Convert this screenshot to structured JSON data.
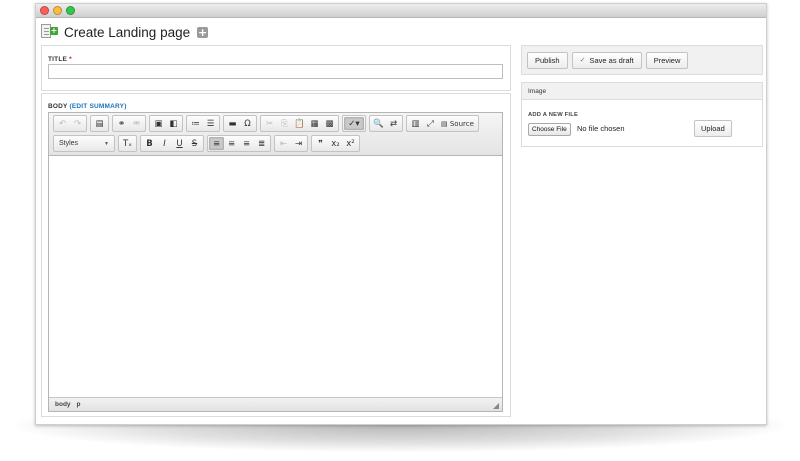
{
  "header": {
    "title": "Create Landing page",
    "add_label": "+"
  },
  "title_field": {
    "label": "TITLE",
    "required_mark": "*",
    "value": ""
  },
  "body_field": {
    "label": "BODY",
    "edit_summary": "(EDIT SUMMARY)"
  },
  "editor": {
    "toolbar_row1": [
      {
        "group": [
          {
            "name": "undo-icon",
            "glyph": "↶",
            "disabled": true
          },
          {
            "name": "redo-icon",
            "glyph": "↷",
            "disabled": true
          }
        ]
      },
      {
        "group": [
          {
            "name": "templates-icon",
            "glyph": "▤"
          }
        ]
      },
      {
        "group": [
          {
            "name": "link-icon",
            "glyph": "⚭"
          },
          {
            "name": "unlink-icon",
            "glyph": "⚮",
            "disabled": true
          }
        ]
      },
      {
        "group": [
          {
            "name": "image-icon",
            "glyph": "▣"
          },
          {
            "name": "media-icon",
            "glyph": "◧"
          }
        ]
      },
      {
        "group": [
          {
            "name": "numbered-list-icon",
            "glyph": "≔"
          },
          {
            "name": "bulleted-list-icon",
            "glyph": "☰"
          }
        ]
      },
      {
        "group": [
          {
            "name": "horizontal-rule-icon",
            "glyph": "▬"
          },
          {
            "name": "special-char-icon",
            "glyph": "Ω"
          }
        ]
      },
      {
        "group": [
          {
            "name": "cut-icon",
            "glyph": "✂",
            "disabled": true
          },
          {
            "name": "copy-icon",
            "glyph": "⎘",
            "disabled": true
          },
          {
            "name": "paste-icon",
            "glyph": "📋"
          },
          {
            "name": "paste-text-icon",
            "glyph": "▦"
          },
          {
            "name": "paste-word-icon",
            "glyph": "▩"
          }
        ]
      },
      {
        "group": [
          {
            "name": "spellcheck-icon",
            "glyph": "✓▾",
            "active": true
          }
        ]
      },
      {
        "group": [
          {
            "name": "find-icon",
            "glyph": "🔍"
          },
          {
            "name": "replace-icon",
            "glyph": "⇄"
          }
        ]
      },
      {
        "group": [
          {
            "name": "show-blocks-icon",
            "glyph": "▥"
          },
          {
            "name": "maximize-icon",
            "glyph": "⤢"
          },
          {
            "name": "source-button",
            "glyph": "▤",
            "label": "Source"
          }
        ]
      }
    ],
    "styles_label": "Styles",
    "toolbar_row2": [
      {
        "group": [
          {
            "name": "remove-format-icon",
            "glyph": "Tₓ"
          }
        ]
      },
      {
        "group": [
          {
            "name": "bold-icon",
            "glyph": "B"
          },
          {
            "name": "italic-icon",
            "glyph": "I"
          },
          {
            "name": "underline-icon",
            "glyph": "U"
          },
          {
            "name": "strikethrough-icon",
            "glyph": "S"
          }
        ]
      },
      {
        "group": [
          {
            "name": "align-left-icon",
            "glyph": "≡",
            "active": true
          },
          {
            "name": "align-center-icon",
            "glyph": "≡"
          },
          {
            "name": "align-right-icon",
            "glyph": "≡"
          },
          {
            "name": "justify-icon",
            "glyph": "≣"
          }
        ]
      },
      {
        "group": [
          {
            "name": "outdent-icon",
            "glyph": "⇤",
            "disabled": true
          },
          {
            "name": "indent-icon",
            "glyph": "⇥"
          }
        ]
      },
      {
        "group": [
          {
            "name": "blockquote-icon",
            "glyph": "❞"
          },
          {
            "name": "subscript-icon",
            "glyph": "x₂"
          },
          {
            "name": "superscript-icon",
            "glyph": "x²"
          }
        ]
      }
    ],
    "path": [
      "body",
      "p"
    ]
  },
  "actions": {
    "publish": "Publish",
    "save_draft": "Save as draft",
    "save_check": "✓",
    "preview": "Preview"
  },
  "image_panel": {
    "heading": "Image",
    "add_file_label": "ADD A NEW FILE",
    "choose_file": "Choose File",
    "no_file": "No file chosen",
    "upload": "Upload"
  },
  "colors": {
    "link": "#1b73b8",
    "required": "#e0001a",
    "icon_green": "#3fa535"
  }
}
